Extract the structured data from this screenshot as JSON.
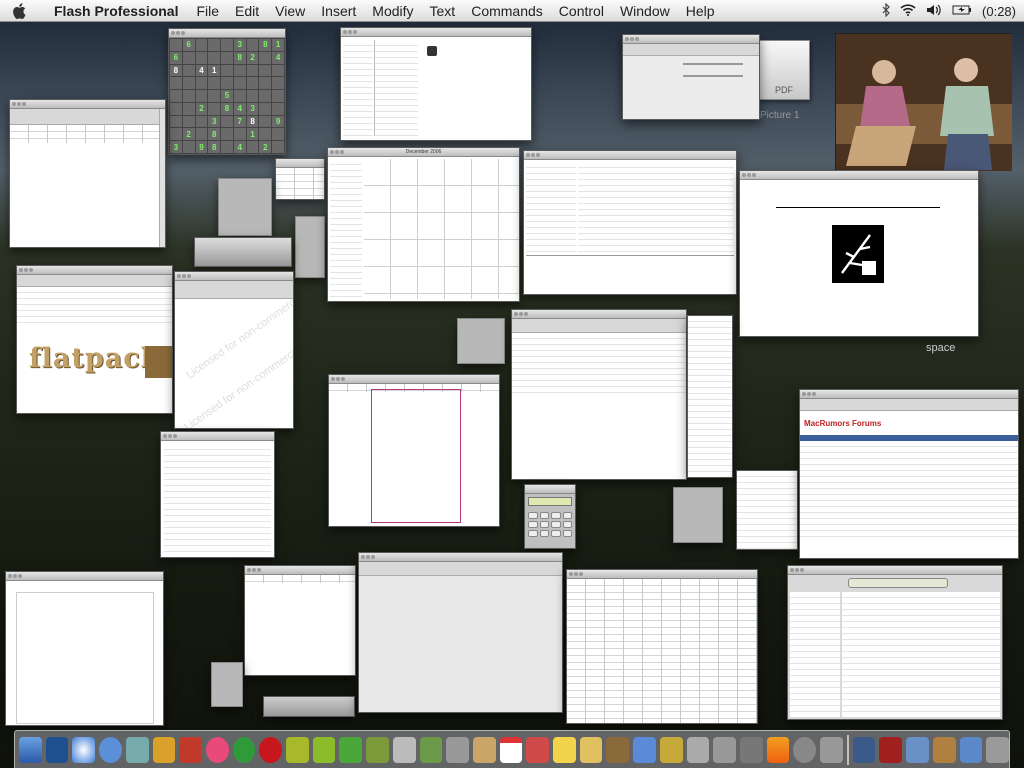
{
  "menubar": {
    "app_name": "Flash Professional",
    "menus": [
      "File",
      "Edit",
      "View",
      "Insert",
      "Modify",
      "Text",
      "Commands",
      "Control",
      "Window",
      "Help"
    ],
    "battery": "(0:28)"
  },
  "desktop": {
    "space_label": "space",
    "picture_label": "Picture 1",
    "pdf_label": "PDF"
  },
  "flatpack": {
    "logo": "flatpack"
  },
  "watermark": "Licensed for non-commercial",
  "forum": {
    "brand": "MacRumors Forums"
  },
  "sudoku": {
    "cells": [
      "",
      "6",
      "",
      "",
      "",
      "3",
      "",
      "8",
      "1",
      "6",
      "",
      "",
      "",
      "",
      "8",
      "2",
      "",
      "4",
      "8",
      "",
      "4",
      "1",
      "",
      "",
      "",
      "",
      "",
      "",
      "",
      "",
      "",
      "",
      "",
      "",
      "",
      "",
      "",
      "",
      "",
      "",
      "5",
      "",
      "",
      "",
      "",
      "",
      "",
      "2",
      "",
      "8",
      "4",
      "3",
      "",
      "",
      "",
      "",
      "",
      "3",
      "",
      "7",
      "8",
      "",
      "9",
      "",
      "2",
      "",
      "8",
      "",
      "",
      "1",
      "",
      "",
      "3",
      "",
      "9",
      "8",
      "",
      "4",
      "",
      "2",
      ""
    ],
    "white_cells": [
      18,
      20,
      21,
      58,
      60
    ]
  },
  "calendar": {
    "title": "December 2006"
  }
}
